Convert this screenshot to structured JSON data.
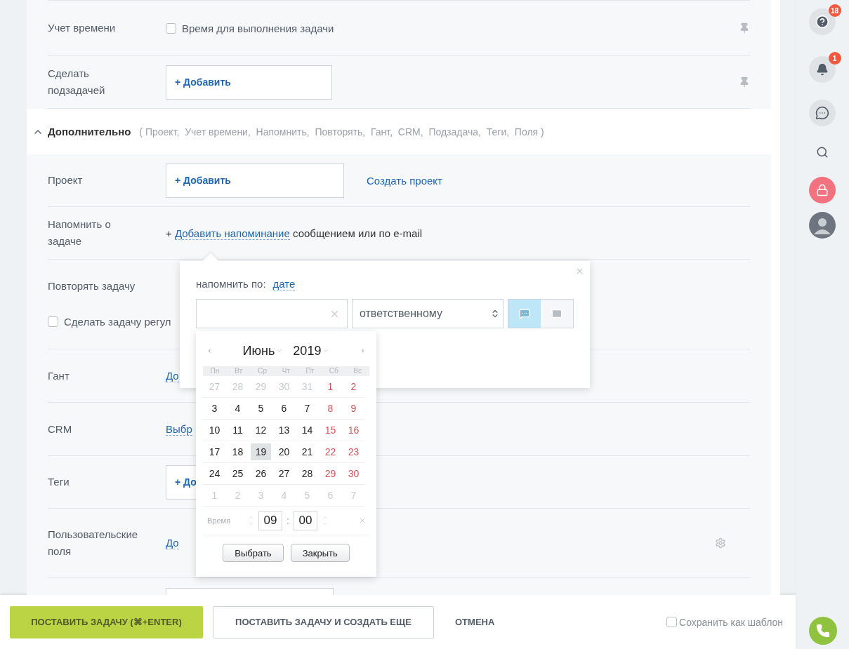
{
  "top_rows": [
    {
      "kind": "checkbox",
      "label": "Учет времени",
      "checkbox": {
        "label": "Время для выполнения задачи",
        "checked": false
      },
      "pin": true
    },
    {
      "kind": "add",
      "label": "Сделать\nподзадачей",
      "button": "+ Добавить",
      "pin": true
    }
  ],
  "additional": {
    "expanded": true,
    "title": "Дополнительно",
    "summary": "( Проект,  Учет времени,  Напомнить,  Повторять,  Гант,  CRM,  Подзадача,  Теги,  Поля )"
  },
  "extra_rows": [
    {
      "kind": "add",
      "label": "Проект",
      "button": "+ Добавить",
      "link": "Создать проект"
    },
    {
      "kind": "reminder",
      "label": "Напомнить о\nзадаче",
      "prefix": "+",
      "link": "Добавить напоминание",
      "rest": "сообщением или по e-mail"
    },
    {
      "kind": "repeat",
      "label": "Повторять задачу",
      "checkbox": {
        "label": "Сделать задачу регул",
        "checked": false
      }
    },
    {
      "kind": "link",
      "label": "Гант",
      "link": "До"
    },
    {
      "kind": "link",
      "label": "CRM",
      "link": "Выбр"
    },
    {
      "kind": "add",
      "label": "Теги",
      "button": "+ До"
    },
    {
      "kind": "link",
      "label": "Пользовательские\nполя",
      "link": "До",
      "gear": true
    },
    {
      "kind": "field"
    }
  ],
  "reminder_popup": {
    "by_label": "напомнить по:",
    "by_value": "дате",
    "recipient": "ответственному",
    "channels": [
      {
        "kind": "message",
        "selected": true
      },
      {
        "kind": "email",
        "selected": false
      }
    ]
  },
  "calendar": {
    "month": "Июнь",
    "year": "2019",
    "weekdays": [
      "Пн",
      "Вт",
      "Ср",
      "Чт",
      "Пт",
      "Сб",
      "Вс"
    ],
    "weeks": [
      [
        {
          "day": "27",
          "kind": "outside",
          "selected": false
        },
        {
          "day": "28",
          "kind": "outside",
          "selected": false
        },
        {
          "day": "29",
          "kind": "outside",
          "selected": false
        },
        {
          "day": "30",
          "kind": "outside",
          "selected": false
        },
        {
          "day": "31",
          "kind": "outside",
          "selected": false
        },
        {
          "day": "1",
          "kind": "weekend",
          "selected": false
        },
        {
          "day": "2",
          "kind": "weekend",
          "selected": false
        }
      ],
      [
        {
          "day": "3",
          "kind": "weekday",
          "selected": false
        },
        {
          "day": "4",
          "kind": "weekday",
          "selected": false
        },
        {
          "day": "5",
          "kind": "weekday",
          "selected": false
        },
        {
          "day": "6",
          "kind": "weekday",
          "selected": false
        },
        {
          "day": "7",
          "kind": "weekday",
          "selected": false
        },
        {
          "day": "8",
          "kind": "weekend",
          "selected": false
        },
        {
          "day": "9",
          "kind": "weekend",
          "selected": false
        }
      ],
      [
        {
          "day": "10",
          "kind": "weekday",
          "selected": false
        },
        {
          "day": "11",
          "kind": "weekday",
          "selected": false
        },
        {
          "day": "12",
          "kind": "weekday",
          "selected": false
        },
        {
          "day": "13",
          "kind": "weekday",
          "selected": false
        },
        {
          "day": "14",
          "kind": "weekday",
          "selected": false
        },
        {
          "day": "15",
          "kind": "weekend",
          "selected": false
        },
        {
          "day": "16",
          "kind": "weekend",
          "selected": false
        }
      ],
      [
        {
          "day": "17",
          "kind": "weekday",
          "selected": false
        },
        {
          "day": "18",
          "kind": "weekday",
          "selected": false
        },
        {
          "day": "19",
          "kind": "weekday",
          "selected": true
        },
        {
          "day": "20",
          "kind": "weekday",
          "selected": false
        },
        {
          "day": "21",
          "kind": "weekday",
          "selected": false
        },
        {
          "day": "22",
          "kind": "weekend",
          "selected": false
        },
        {
          "day": "23",
          "kind": "weekend",
          "selected": false
        }
      ],
      [
        {
          "day": "24",
          "kind": "weekday",
          "selected": false
        },
        {
          "day": "25",
          "kind": "weekday",
          "selected": false
        },
        {
          "day": "26",
          "kind": "weekday",
          "selected": false
        },
        {
          "day": "27",
          "kind": "weekday",
          "selected": false
        },
        {
          "day": "28",
          "kind": "weekday",
          "selected": false
        },
        {
          "day": "29",
          "kind": "weekend",
          "selected": false
        },
        {
          "day": "30",
          "kind": "weekend",
          "selected": false
        }
      ],
      [
        {
          "day": "1",
          "kind": "outside",
          "selected": false
        },
        {
          "day": "2",
          "kind": "outside",
          "selected": false
        },
        {
          "day": "3",
          "kind": "outside",
          "selected": false
        },
        {
          "day": "4",
          "kind": "outside",
          "selected": false
        },
        {
          "day": "5",
          "kind": "outside",
          "selected": false
        },
        {
          "day": "6",
          "kind": "outside",
          "selected": false
        },
        {
          "day": "7",
          "kind": "outside",
          "selected": false
        }
      ]
    ],
    "time_label": "Время",
    "hours": "09",
    "separator": ":",
    "minutes": "00",
    "buttons": [
      "Выбрать",
      "Закрыть"
    ]
  },
  "footer": {
    "primary": "ПОСТАВИТЬ ЗАДАЧУ (⌘+ENTER)",
    "secondary": "ПОСТАВИТЬ ЗАДАЧУ И СОЗДАТЬ ЕЩЕ",
    "cancel": "ОТМЕНА",
    "template": {
      "label": "Сохранить как шаблон",
      "checked": false
    }
  },
  "sidebar": [
    {
      "kind": "help",
      "badge": "18"
    },
    {
      "kind": "bell",
      "badge": "1"
    },
    {
      "kind": "chat"
    },
    {
      "kind": "search"
    },
    {
      "kind": "lock"
    },
    {
      "kind": "avatar"
    }
  ],
  "call_button": {
    "kind": "phone"
  }
}
